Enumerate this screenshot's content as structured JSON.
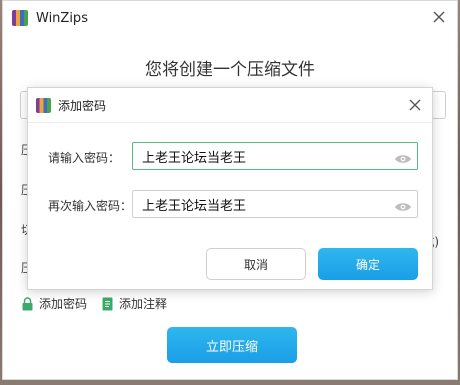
{
  "window": {
    "title": "WinZips",
    "heading": "您将创建一个压缩文件",
    "side_labels": [
      "压",
      "压",
      "切",
      "压"
    ],
    "right_hint": "式)",
    "add_password_link": "添加密码",
    "add_comment_link": "添加注释",
    "compress_button": "立即压缩"
  },
  "dialog": {
    "title": "添加密码",
    "password_label": "请输入密码：",
    "password_value": "上老王论坛当老王",
    "confirm_label": "再次输入密码：",
    "confirm_value": "上老王论坛当老王",
    "cancel_button": "取消",
    "ok_button": "确定"
  },
  "colors": {
    "accent": "#1a9ee6",
    "focus_border": "#5ab88a",
    "link_icon": "#3aaa6a"
  }
}
